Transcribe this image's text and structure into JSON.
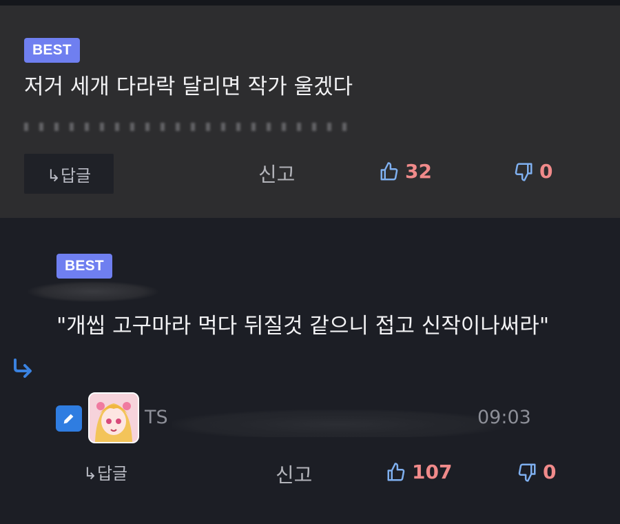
{
  "comments": [
    {
      "badge": "BEST",
      "text": "저거 세개 다라락 달리면 작가 울겠다",
      "reply_label": "↳답글",
      "report_label": "신고",
      "upvotes": "32",
      "downvotes": "0"
    },
    {
      "badge": "BEST",
      "text": "\"개씹 고구마라 먹다 뒤질것 같으니 접고 신작이나써라\"",
      "meta_prefix": "TS",
      "timestamp": "09:03",
      "reply_label": "↳답글",
      "report_label": "신고",
      "upvotes": "107",
      "downvotes": "0"
    }
  ],
  "colors": {
    "badge": "#6f7ff0",
    "vote": "#f08a8a",
    "icon_blue": "#2f7de1"
  },
  "icons": [
    "thumbs-up-icon",
    "thumbs-down-icon",
    "reply-arrow-icon",
    "pencil-icon"
  ]
}
